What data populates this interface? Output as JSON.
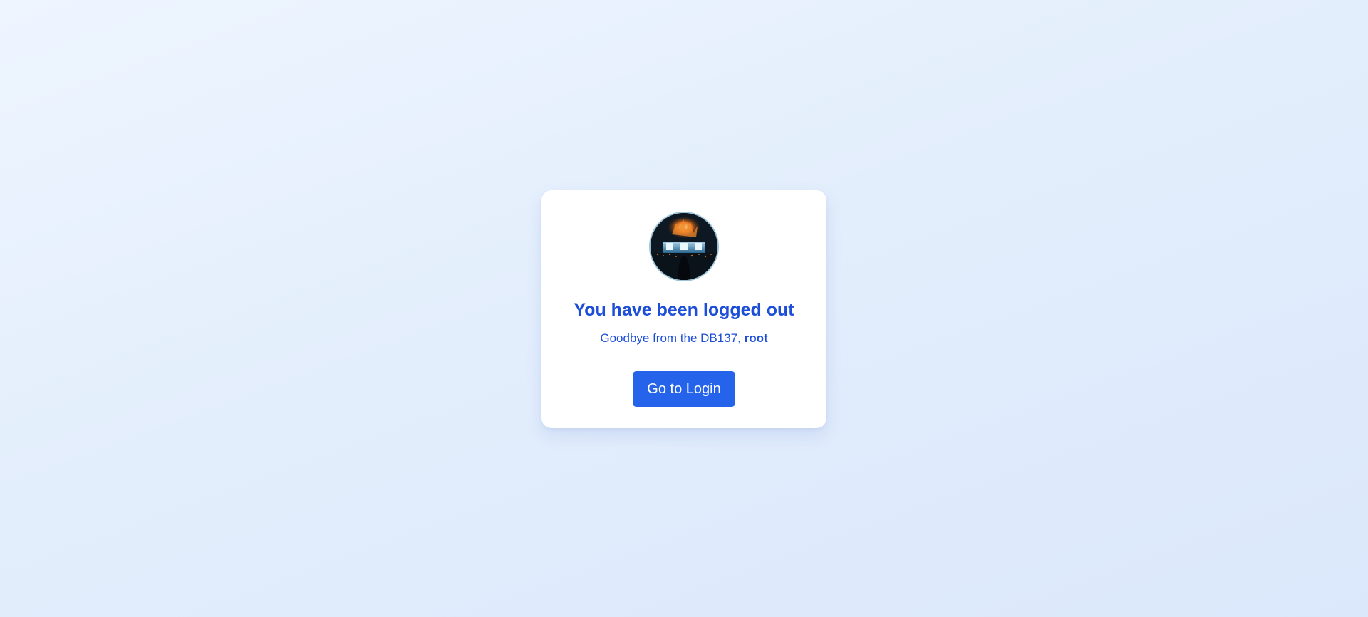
{
  "logout": {
    "title": "You have been logged out",
    "goodbye_prefix": "Goodbye from the DB137, ",
    "username": "root",
    "button_label": "Go to Login"
  },
  "avatar": {
    "icon": "concert-photo-avatar"
  },
  "colors": {
    "accent": "#1d4ed8",
    "button": "#2563eb",
    "card": "#ffffff",
    "background": "#e6f0fd"
  }
}
